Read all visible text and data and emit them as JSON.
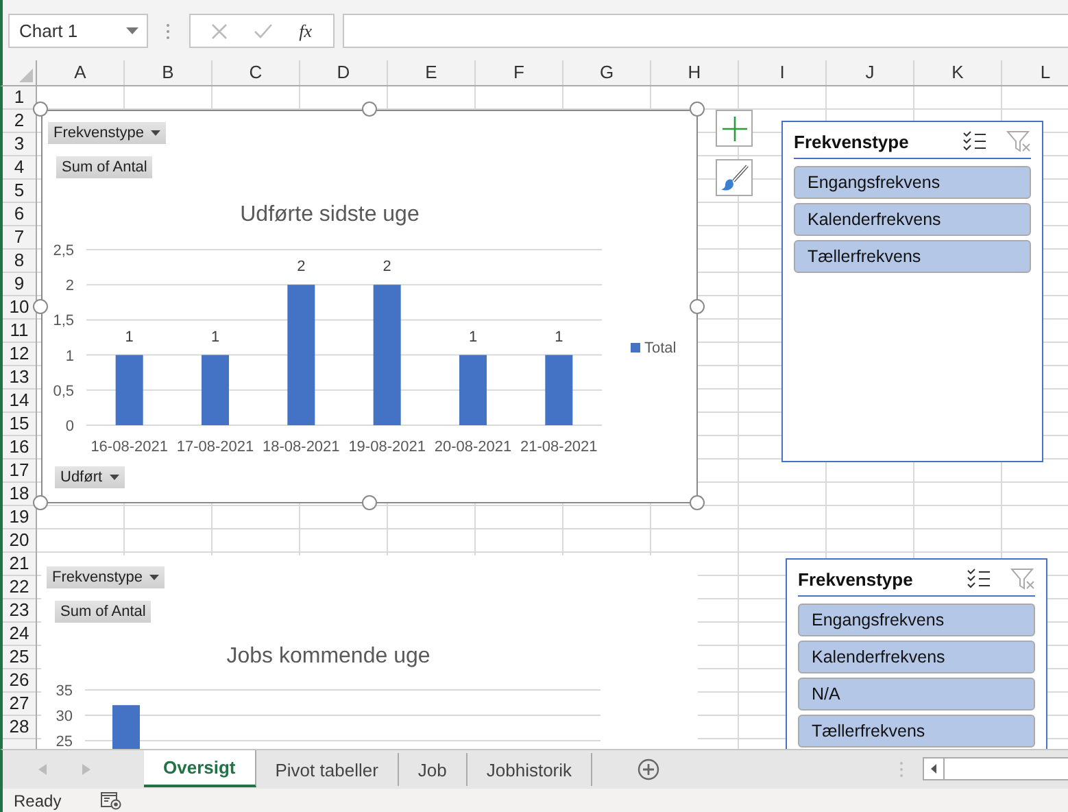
{
  "name_box": {
    "value": "Chart 1"
  },
  "formula_bar": {
    "function_label": "fx"
  },
  "columns": [
    "A",
    "B",
    "C",
    "D",
    "E",
    "F",
    "G",
    "H",
    "I",
    "J",
    "K",
    "L"
  ],
  "rows": [
    "1",
    "2",
    "3",
    "4",
    "5",
    "6",
    "7",
    "8",
    "9",
    "10",
    "11",
    "12",
    "13",
    "14",
    "15",
    "16",
    "17",
    "18",
    "19",
    "20",
    "21",
    "22",
    "23",
    "24",
    "25",
    "26",
    "27",
    "28"
  ],
  "charts": [
    {
      "selected": true,
      "buttons": [
        {
          "label": "Frekvenstype",
          "kind": "filter"
        },
        {
          "label": "Sum of Antal",
          "kind": "value"
        },
        {
          "label": "Udført",
          "kind": "axis"
        }
      ],
      "chart_data": {
        "type": "bar",
        "title": "Udførte sidste uge",
        "grid": true,
        "categories": [
          "16-08-2021",
          "17-08-2021",
          "18-08-2021",
          "19-08-2021",
          "20-08-2021",
          "21-08-2021"
        ],
        "series": [
          {
            "name": "Total",
            "color": "#4472c4",
            "values": [
              1,
              1,
              2,
              2,
              1,
              1
            ]
          }
        ],
        "ylim": [
          0,
          2.5
        ],
        "yticks": [
          {
            "value": 0,
            "label": "0"
          },
          {
            "value": 0.5,
            "label": "0,5"
          },
          {
            "value": 1,
            "label": "1"
          },
          {
            "value": 1.5,
            "label": "1,5"
          },
          {
            "value": 2,
            "label": "2"
          },
          {
            "value": 2.5,
            "label": "2,5"
          }
        ],
        "data_labels": true
      }
    },
    {
      "selected": false,
      "buttons": [
        {
          "label": "Frekvenstype",
          "kind": "filter"
        },
        {
          "label": "Sum of Antal",
          "kind": "value"
        }
      ],
      "chart_data": {
        "type": "bar",
        "title": "Jobs kommende uge",
        "grid": true,
        "series": [
          {
            "color": "#4472c4",
            "values": [
              32
            ]
          }
        ],
        "ylim": [
          0,
          35
        ],
        "yticks": [
          25,
          30,
          35
        ]
      }
    }
  ],
  "slicers": [
    {
      "title": "Frekvenstype",
      "items": [
        {
          "label": "Engangsfrekvens",
          "selected": true
        },
        {
          "label": "Kalenderfrekvens",
          "selected": true
        },
        {
          "label": "Tællerfrekvens",
          "selected": true
        }
      ]
    },
    {
      "title": "Frekvenstype",
      "items": [
        {
          "label": "Engangsfrekvens",
          "selected": true
        },
        {
          "label": "Kalenderfrekvens",
          "selected": true
        },
        {
          "label": "N/A",
          "selected": true
        },
        {
          "label": "Tællerfrekvens",
          "selected": true
        }
      ]
    }
  ],
  "sheet_tabs": [
    {
      "label": "Oversigt",
      "selected": true
    },
    {
      "label": "Pivot tabeller",
      "selected": false
    },
    {
      "label": "Job",
      "selected": false
    },
    {
      "label": "Jobhistorik",
      "selected": false
    }
  ],
  "status_bar": {
    "text": "Ready"
  }
}
